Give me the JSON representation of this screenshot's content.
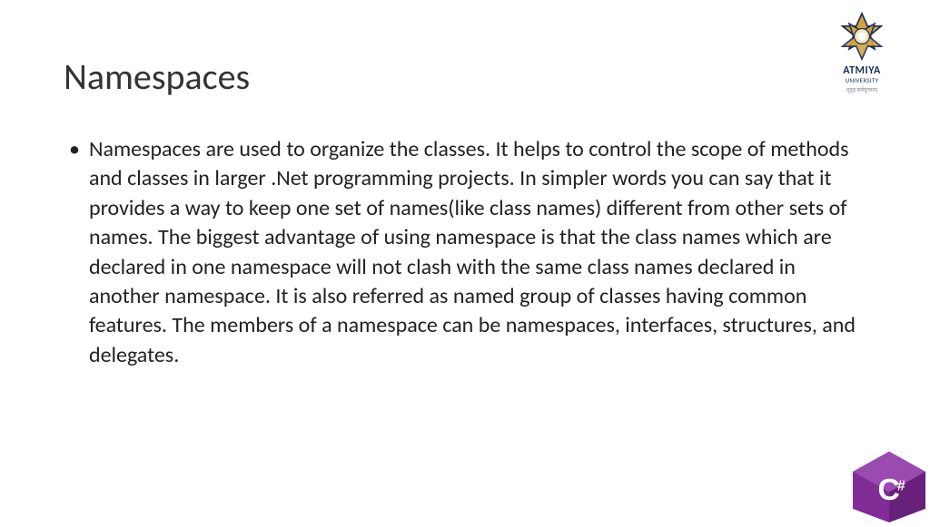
{
  "slide": {
    "title": "Namespaces",
    "bullet": "•",
    "body": "Namespaces are used to organize the classes. It helps to control the scope of methods and classes in larger .Net programming projects. In simpler words you can say that it provides a way to keep one set of names(like class names) different from other sets of names. The biggest advantage of using namespace is that the class names which are declared in one namespace will not clash with the same class names declared in another namespace. It is also referred as named group of classes having common features. The members of a namespace can be namespaces, interfaces, structures, and delegates."
  },
  "branding": {
    "name": "ATMIYA",
    "sub": "UNIVERSITY",
    "tagline": "मुदृढ सर्वमुत्तमम्"
  },
  "csharp": {
    "label": "C#"
  }
}
